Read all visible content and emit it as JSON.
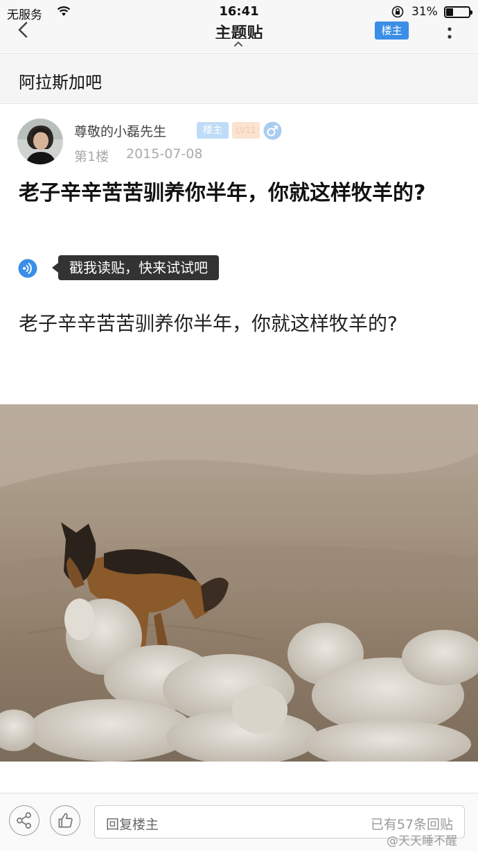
{
  "status_bar": {
    "carrier": "无服务",
    "time": "16:41",
    "battery_text": "31%",
    "battery_level": 0.31
  },
  "nav": {
    "title": "主题贴",
    "op_badge": "楼主"
  },
  "forum": {
    "name": "阿拉斯加吧"
  },
  "post": {
    "username": "尊敬的小磊先生",
    "op_badge": "楼主",
    "level_badge": "LV11",
    "floor": "第1楼",
    "date": "2015-07-08",
    "title": "老子辛辛苦苦驯养你半年，你就这样牧羊的?",
    "tooltip": "戳我读贴，快来试试吧",
    "body": "老子辛辛苦苦驯养你半年，你就这样牧羊的?"
  },
  "bottom_bar": {
    "reply_placeholder": "回复楼主",
    "reply_count": "已有57条回贴"
  },
  "watermark": "@天天睡不醒",
  "colors": {
    "accent": "#3a8ee6",
    "op_badge_light": "#bfdcf6",
    "level_badge": "#fbe3d0",
    "tooltip_bg": "#333333"
  },
  "icons": [
    "wifi-icon",
    "lock-rotation-icon",
    "battery-icon",
    "back-chevron-icon",
    "caret-up-icon",
    "more-vertical-icon",
    "male-gender-icon",
    "speaker-icon",
    "share-icon",
    "thumbs-up-icon"
  ]
}
